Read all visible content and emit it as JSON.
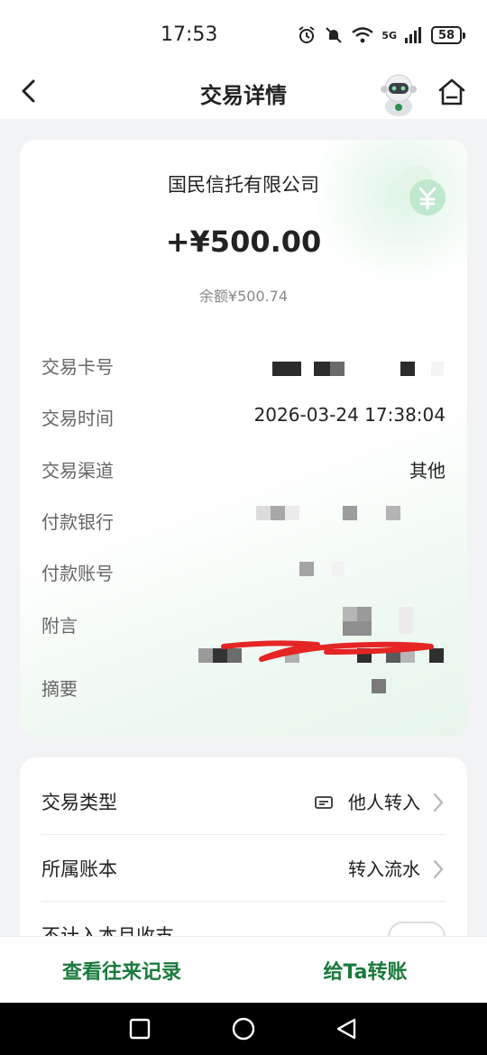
{
  "status": {
    "time": "17:53",
    "battery": "58",
    "network": "5G"
  },
  "nav": {
    "title": "交易详情"
  },
  "transaction": {
    "payee": "国民信托有限公司",
    "amount": "+¥500.00",
    "balance": "余额¥500.74",
    "rows": {
      "card_no_label": "交易卡号",
      "time_label": "交易时间",
      "time_value": "2026-03-24 17:38:04",
      "channel_label": "交易渠道",
      "channel_value": "其他",
      "bank_label": "付款银行",
      "account_label": "付款账号",
      "memo_label": "附言",
      "summary_label": "摘要"
    }
  },
  "details": {
    "type_label": "交易类型",
    "type_value": "他人转入",
    "ledger_label": "所属账本",
    "ledger_value": "转入流水",
    "exclude_label": "不计入本月收支"
  },
  "actions": {
    "history": "查看往来记录",
    "transfer": "给Ta转账"
  },
  "colors": {
    "accent": "#1a7a3c",
    "coin": "#bfe8cc"
  }
}
